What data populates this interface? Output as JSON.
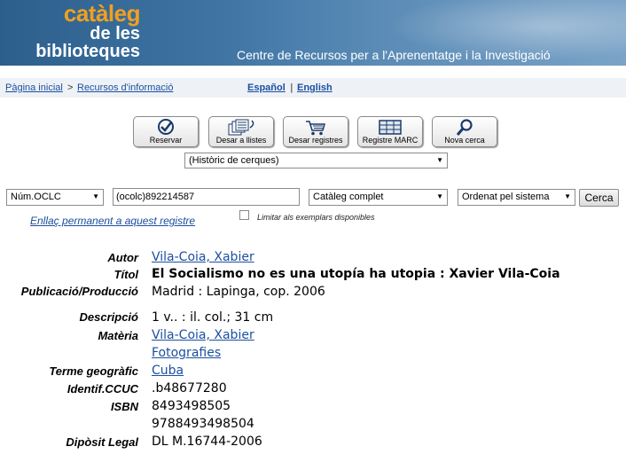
{
  "banner": {
    "logo_line1": "catàleg",
    "logo_line2": "de les",
    "logo_line3": "biblioteques",
    "subtitle": "Centre de Recursos per a l'Aprenentatge i la Investigació"
  },
  "nav": {
    "home": "Pàgina inicial",
    "separator": ">",
    "resources": "Recursos d'informació",
    "lang_es": "Español",
    "lang_sep": "|",
    "lang_en": "English"
  },
  "toolbar": {
    "reserve": "Reservar",
    "save_lists": "Desar a llistes",
    "save_records": "Desar registres",
    "marc": "Registre MARC",
    "new_search": "Nova cerca"
  },
  "history": {
    "selected": "(Històric de cerques)"
  },
  "search": {
    "field_type": "Núm.OCLC",
    "query": "(ocolc)892214587",
    "scope": "Catàleg complet",
    "sort": "Ordenat pel sistema",
    "button": "Cerca",
    "limit_label": "Limitar als exemplars disponibles"
  },
  "permalink": "Enllaç permanent a aquest registre",
  "record": {
    "author_label": "Autor",
    "author": "Vila-Coia, Xabier",
    "title_label": "Títol",
    "title": "El Socialismo no es una utopía ha utopia : Xavier Vila-Coia",
    "pub_label": "Publicació/Producció",
    "pub": "Madrid : Lapinga, cop. 2006",
    "desc_label": "Descripció",
    "desc": "1 v.. : il. col.; 31 cm",
    "subject_label": "Matèria",
    "subject1": "Vila-Coia, Xabier",
    "subject2": "Fotografies",
    "geo_label": "Terme geogràfic",
    "geo": "Cuba",
    "ccuc_label": "Identif.CCUC",
    "ccuc": ".b48677280",
    "isbn_label": "ISBN",
    "isbn1": "8493498505",
    "isbn2": "9788493498504",
    "legal_label": "Dipòsit Legal",
    "legal": "DL M.16744-2006"
  },
  "colors": {
    "link": "#1c4fa0",
    "logo_orange": "#f0a020",
    "banner_blue": "#3f74a3"
  }
}
